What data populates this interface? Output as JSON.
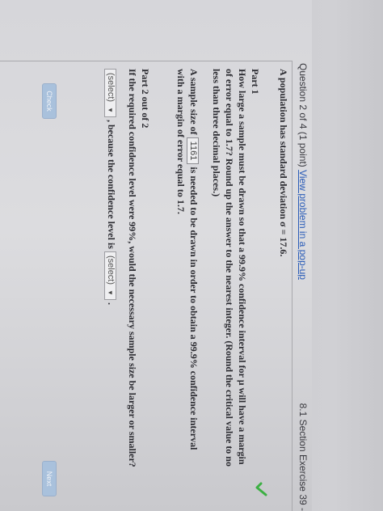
{
  "header": {
    "question": "Question 2 of 4 (1 point)",
    "popup_link": "View problem in a pop-up",
    "section": "8.1 Section Exercise 39 -"
  },
  "problem": {
    "intro": "A population has standard deviation σ = 17.6."
  },
  "part1": {
    "title": "Part 1",
    "line1": "How large a sample must be drawn so that a 99.9% confidence interval for μ will have a margin",
    "line2": "of error equal to 1.7? Round up the answer to the nearest integer. (Round the critical value to no",
    "line3": "less than three decimal places.)",
    "answer_prefix": "A sample size of",
    "answer_value": "1161",
    "answer_suffix": "is needed to be drawn in order to obtain a 99.9% confidence interval",
    "answer_line2": "with a margin of error equal to 1.7."
  },
  "part2": {
    "title": "Part 2 out of 2",
    "question": "If the required confidence level were 99%, would the necessary sample size be larger or smaller?",
    "select1": "(select)",
    "middle_text": ", because the confidence level is",
    "select2": "(select)",
    "end_text": "."
  },
  "buttons": {
    "check": "Check",
    "next": "Next"
  },
  "colors": {
    "link": "#2a5cb8",
    "check_mark": "#3cb043",
    "button": "#a9c1dc"
  }
}
